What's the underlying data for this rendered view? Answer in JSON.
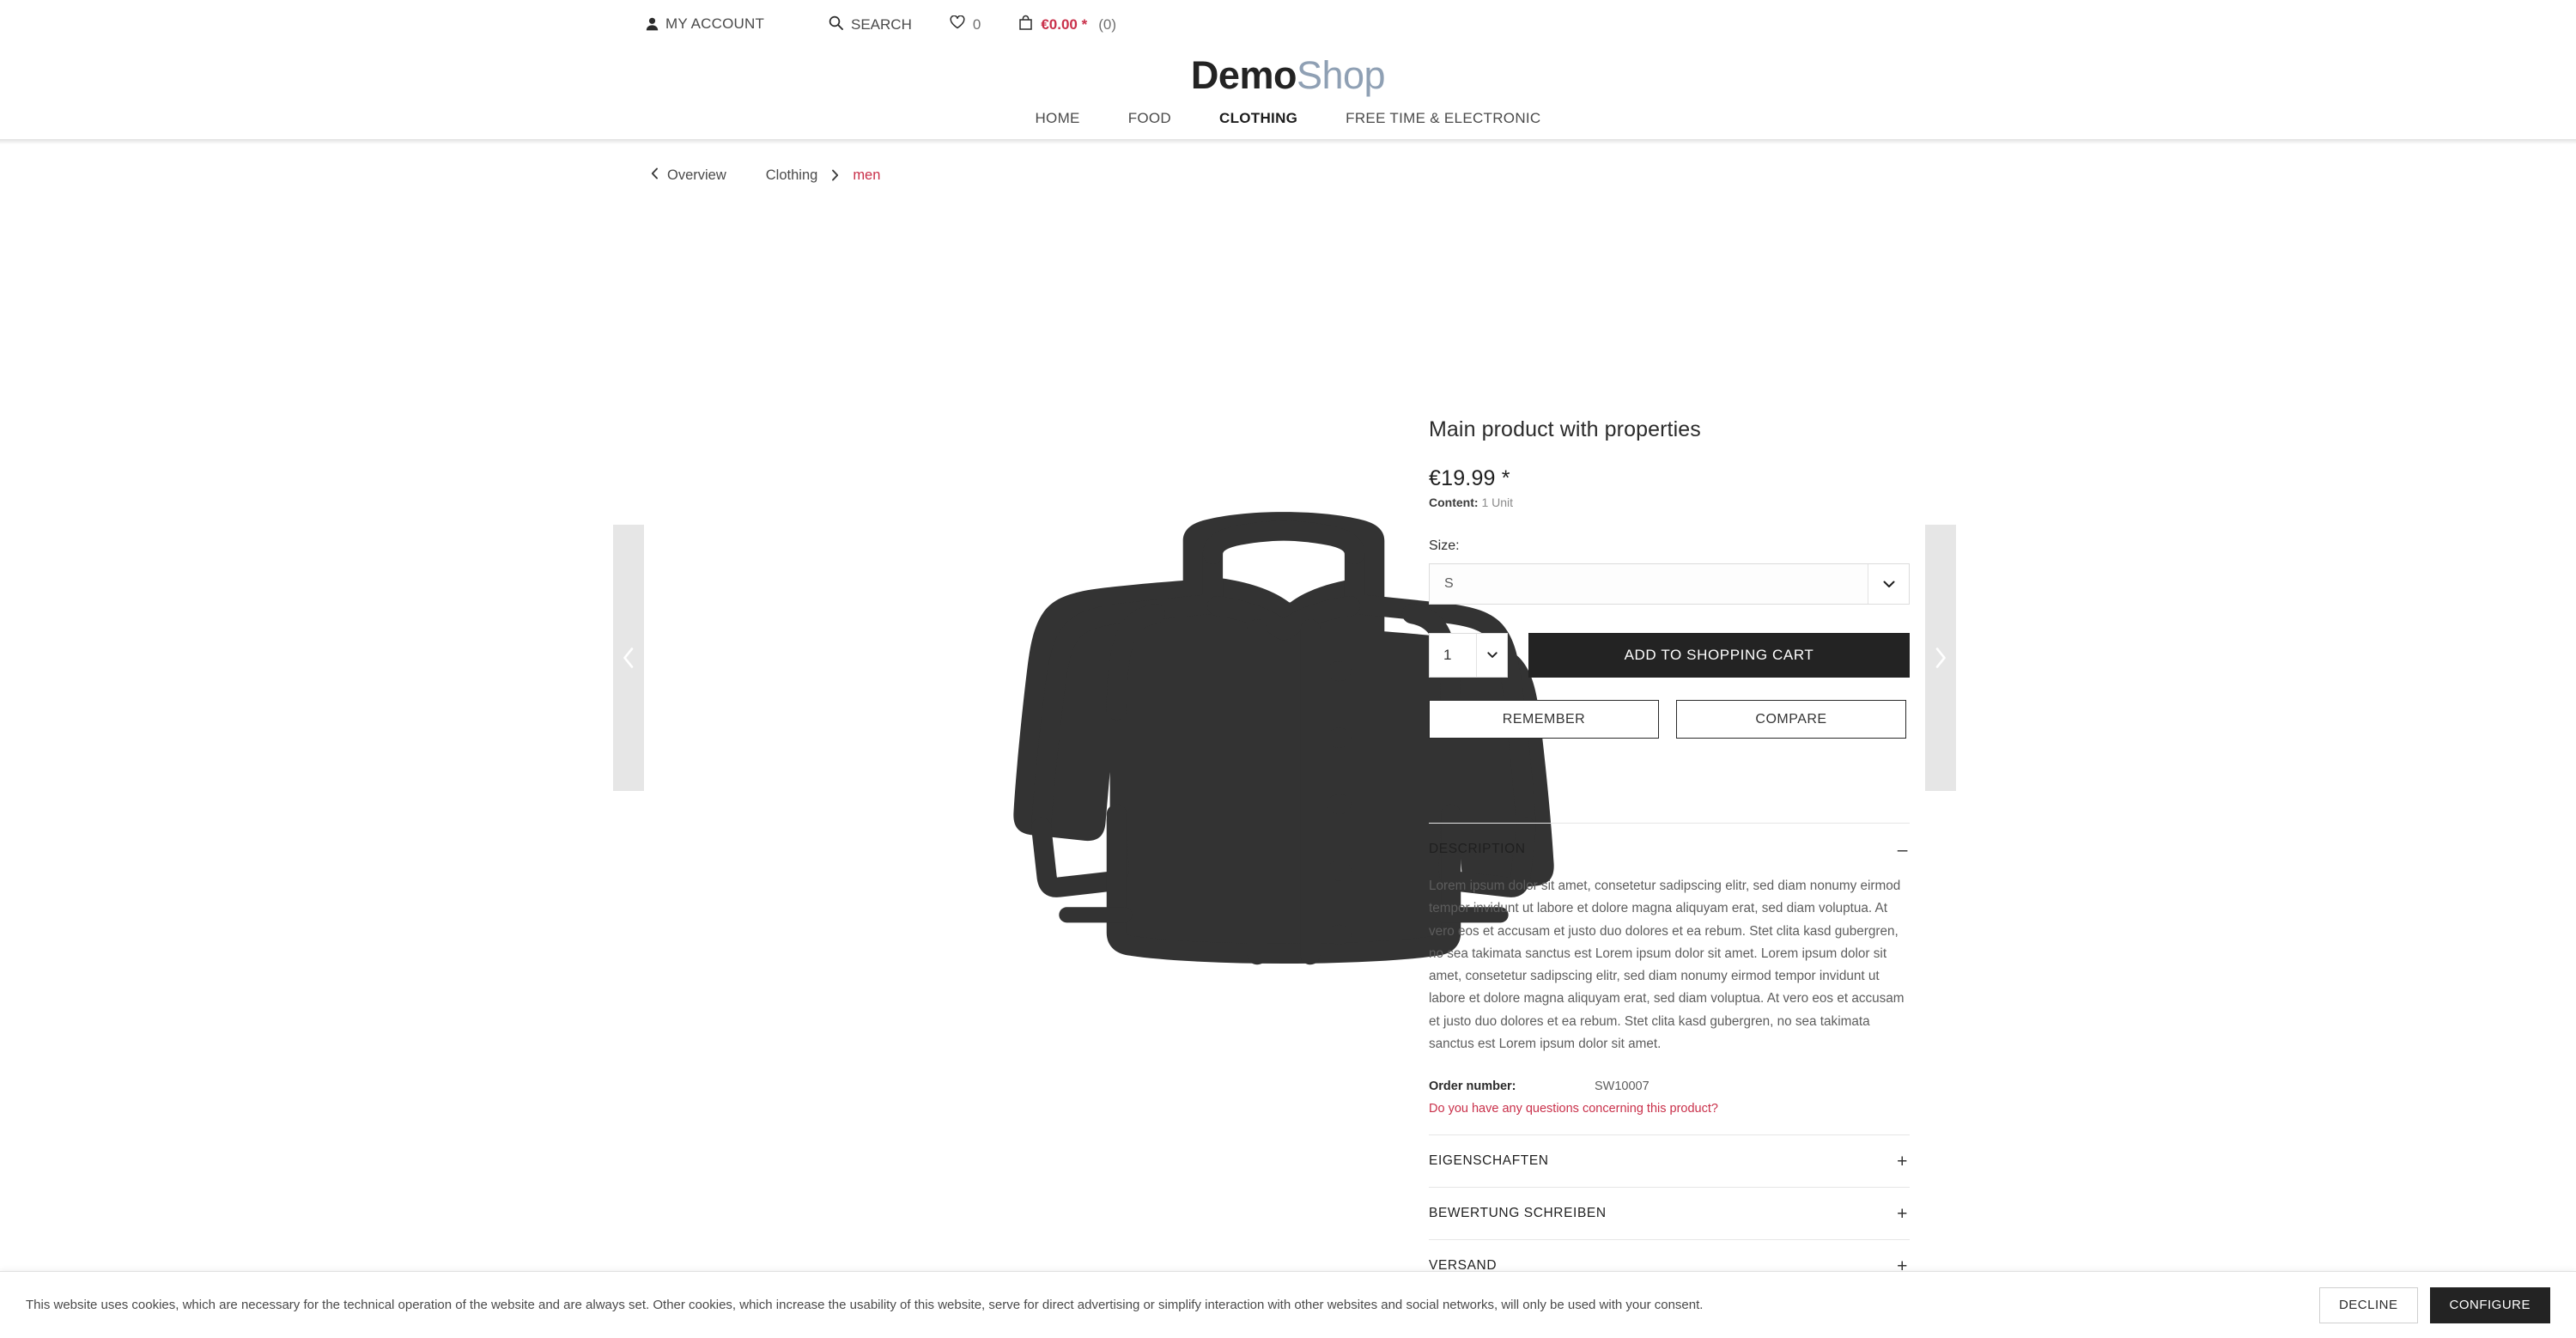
{
  "header": {
    "account_label": "MY ACCOUNT",
    "search_label": "SEARCH",
    "wishlist_count": "0",
    "cart_price": "€0.00 *",
    "cart_count": "(0)",
    "logo_primary": "Demo",
    "logo_secondary": "Shop",
    "nav": [
      {
        "label": "HOME",
        "active": false
      },
      {
        "label": "FOOD",
        "active": false
      },
      {
        "label": "CLOTHING",
        "active": true
      },
      {
        "label": "FREE TIME & ELECTRONIC",
        "active": false
      }
    ]
  },
  "breadcrumb": {
    "back_label": "Overview",
    "category": "Clothing",
    "current": "men"
  },
  "product": {
    "title": "Main product with properties",
    "price": "€19.99 *",
    "content_label": "Content:",
    "content_value": "1 Unit",
    "size_label": "Size:",
    "size_value": "S",
    "quantity_value": "1",
    "add_to_cart_label": "ADD TO SHOPPING CART",
    "remember_label": "REMEMBER",
    "compare_label": "COMPARE",
    "order_number_label": "Order number:",
    "order_number_value": "SW10007",
    "question_link": "Do you have any questions concerning this product?"
  },
  "panels": [
    {
      "title": "DESCRIPTION",
      "sign": "–",
      "expanded": true,
      "body": "Lorem ipsum dolor sit amet, consetetur sadipscing elitr, sed diam nonumy eirmod tempor invidunt ut labore et dolore magna aliquyam erat, sed diam voluptua. At vero eos et accusam et justo duo dolores et ea rebum. Stet clita kasd gubergren, no sea takimata sanctus est Lorem ipsum dolor sit amet. Lorem ipsum dolor sit amet, consetetur sadipscing elitr, sed diam nonumy eirmod tempor invidunt ut labore et dolore magna aliquyam erat, sed diam voluptua. At vero eos et accusam et justo duo dolores et ea rebum. Stet clita kasd gubergren, no sea takimata sanctus est Lorem ipsum dolor sit amet."
    },
    {
      "title": "EIGENSCHAFTEN",
      "sign": "+",
      "expanded": false
    },
    {
      "title": "BEWERTUNG SCHREIBEN",
      "sign": "+",
      "expanded": false
    },
    {
      "title": "VERSAND",
      "sign": "+",
      "expanded": false
    }
  ],
  "cookie": {
    "text": "This website uses cookies, which are necessary for the technical operation of the website and are always set. Other cookies, which increase the usability of this website, serve for direct advertising or simplify interaction with other websites and social networks, will only be used with your consent.",
    "decline_label": "DECLINE",
    "configure_label": "CONFIGURE"
  },
  "colors": {
    "accent_red": "#c9304a",
    "dark": "#232323",
    "logo_secondary": "#8fa0b4"
  }
}
